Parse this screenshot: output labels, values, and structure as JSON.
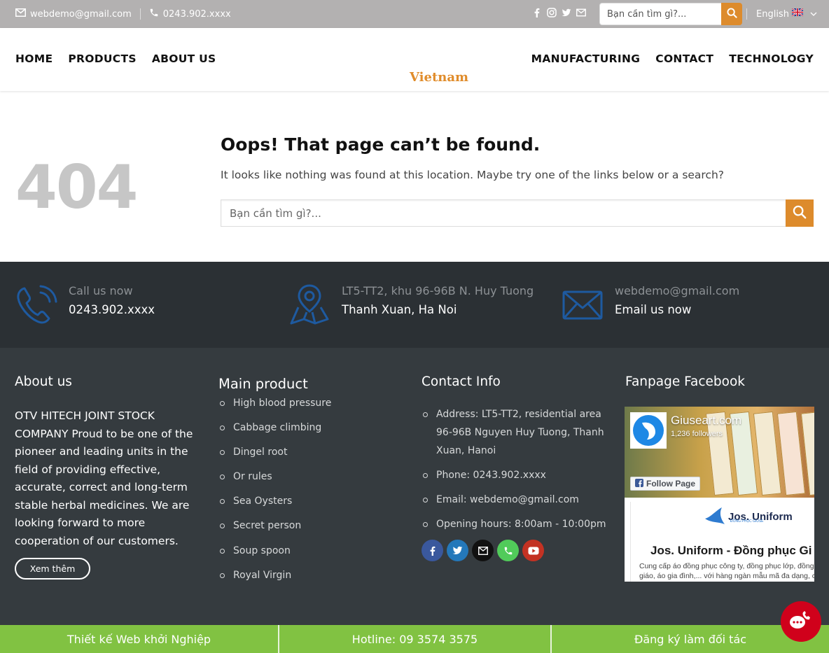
{
  "topbar": {
    "email": "webdemo@gmail.com",
    "phone": "0243.902.xxxx",
    "search_placeholder": "Bạn cần tìm gì?...",
    "language": "English"
  },
  "nav": {
    "left": [
      "HOME",
      "PRODUCTS",
      "ABOUT US"
    ],
    "right": [
      "MANUFACTURING",
      "CONTACT",
      "TECHNOLOGY"
    ],
    "logo_text": "Vietnam"
  },
  "error": {
    "code": "404",
    "title": "Oops! That page can’t be found.",
    "text": "It looks like nothing was found at this location. Maybe try one of the links below or a search?",
    "search_placeholder": "Bạn cần tìm gì?..."
  },
  "contact_strip": [
    {
      "small": "Call us now",
      "big": "0243.902.xxxx",
      "icon": "phone-icon"
    },
    {
      "small": "LT5-TT2, khu 96-96B N. Huy Tuong",
      "big": "Thanh Xuan, Ha Noi",
      "icon": "map-icon"
    },
    {
      "small": "webdemo@gmail.com",
      "big": "Email us now",
      "icon": "envelope-icon"
    }
  ],
  "footer": {
    "about": {
      "title": "About us",
      "text": "OTV HITECH JOINT STOCK COMPANY Proud to be one of the pioneer and leading units in the field of providing effective, accurate, correct and long-term stable herbal medicines. We are looking forward to more cooperation of our customers.",
      "button": "Xem thêm"
    },
    "products": {
      "title": "Main product",
      "items": [
        "High blood pressure",
        "Cabbage climbing",
        "Dingel root",
        "Or rules",
        "Sea Oysters",
        "Secret person",
        "Soup spoon",
        "Royal Virgin"
      ]
    },
    "contact": {
      "title": "Contact Info",
      "items": [
        "Address: LT5-TT2, residential area 96-96B Nguyen Huy Tuong, Thanh Xuan, Hanoi",
        "Phone: 0243.902.xxxx",
        "Email: webdemo@gmail.com",
        "Opening hours: 8:00am - 10:00pm"
      ],
      "socials": [
        {
          "icon": "facebook-icon",
          "color": "#3a589d"
        },
        {
          "icon": "twitter-icon",
          "color": "#2478ba"
        },
        {
          "icon": "email-icon",
          "color": "#111111"
        },
        {
          "icon": "phone-icon",
          "color": "#51cb5a"
        },
        {
          "icon": "youtube-icon",
          "color": "#c33223"
        }
      ]
    },
    "facebook": {
      "title": "Fanpage Facebook",
      "page_name": "Giuseart.com",
      "followers": "1,236 followers",
      "follow_label": "Follow Page",
      "post_brand": "Jos. Uniform",
      "post_brand_sub": "ĐỒNG PHỤC GIUSE",
      "post_title": "Jos. Uniform - Đồng phục Gi",
      "post_desc_1": "Cung cấp áo đồng phục công ty, đồng phục lớp, đồng",
      "post_desc_2": "giáo, áo gia đình,... với hàng ngàn mẫu mã đa dạng, cá"
    }
  },
  "bottombar": [
    "Thiết kế Web khởi Nghiệp",
    "Hotline: 09 3574 3575",
    "Đăng ký làm đối tác"
  ],
  "colors": {
    "accent": "#dd8b2c",
    "topbar": "#b3b1b1",
    "strip": "#2b3034",
    "footer": "#353b3f",
    "bottombar": "#81c242",
    "icon_blue": "#1e5aa0"
  }
}
